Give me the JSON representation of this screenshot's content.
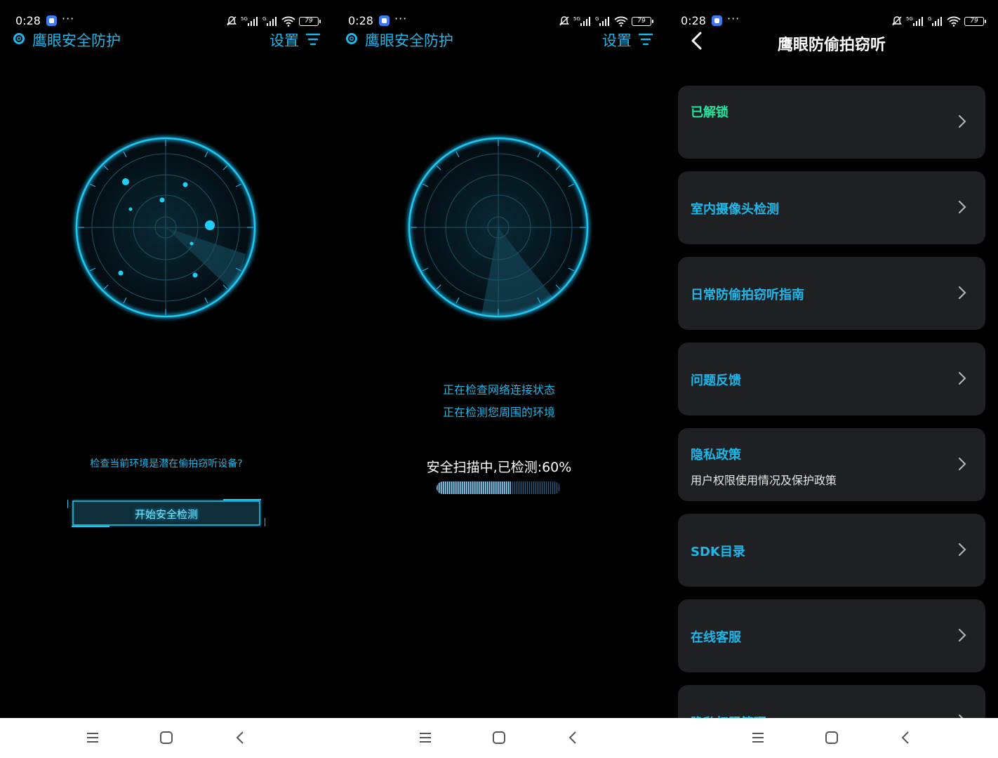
{
  "status": {
    "time": "0:28",
    "dots": "···",
    "battery": "79",
    "network": "5G"
  },
  "header": {
    "title": "鹰眼安全防护",
    "settings": "设置"
  },
  "panel1": {
    "hint": "检查当前环境是潜在偷拍窃听设备?",
    "start_button": "开始安全检测"
  },
  "panel2": {
    "line1": "正在检查网络连接状态",
    "line2": "正在检测您周围的环境",
    "progress_text": "安全扫描中,已检测:60%",
    "progress": 0.6
  },
  "panel3": {
    "title": "鹰眼防偷拍窃听",
    "items": [
      {
        "label": "已解锁",
        "sub": ""
      },
      {
        "label": "室内摄像头检测",
        "sub": ""
      },
      {
        "label": "日常防偷拍窃听指南",
        "sub": ""
      },
      {
        "label": "问题反馈",
        "sub": ""
      },
      {
        "label": "隐私政策",
        "sub": "用户权限使用情况及保护政策"
      },
      {
        "label": "SDK目录",
        "sub": ""
      },
      {
        "label": "在线客服",
        "sub": ""
      },
      {
        "label": "隐私权限管理",
        "sub": ""
      }
    ]
  },
  "colors": {
    "accent": "#1fb6e8",
    "unlocked": "#1ee8a0",
    "card_bg": "#1f2023",
    "background": "#000000"
  }
}
